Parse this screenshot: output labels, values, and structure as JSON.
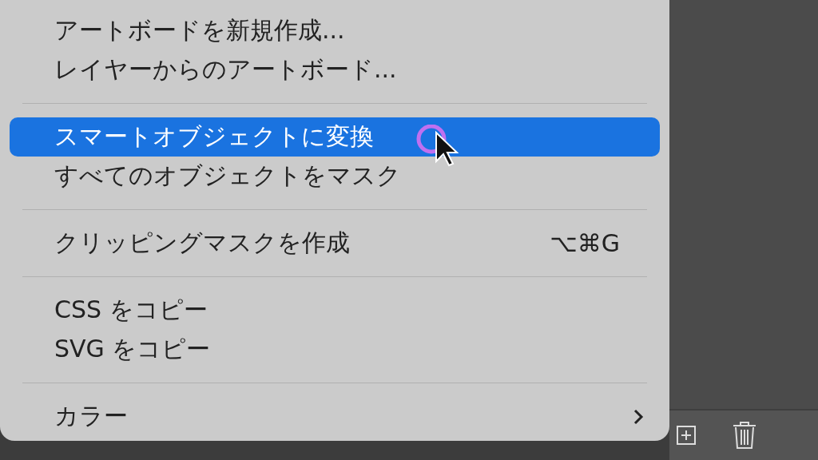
{
  "menu": {
    "groups": [
      {
        "items": [
          {
            "label": "アートボードを新規作成...",
            "selected": false
          },
          {
            "label": "レイヤーからのアートボード...",
            "selected": false
          }
        ]
      },
      {
        "items": [
          {
            "label": "スマートオブジェクトに変換",
            "selected": true
          },
          {
            "label": "すべてのオブジェクトをマスク",
            "selected": false
          }
        ]
      },
      {
        "items": [
          {
            "label": "クリッピングマスクを作成",
            "selected": false,
            "shortcut": "⌥⌘G"
          }
        ]
      },
      {
        "items": [
          {
            "label": "CSS をコピー",
            "selected": false
          },
          {
            "label": "SVG をコピー",
            "selected": false
          }
        ]
      },
      {
        "items": [
          {
            "label": "カラー",
            "selected": false,
            "submenu": true
          }
        ]
      }
    ]
  }
}
